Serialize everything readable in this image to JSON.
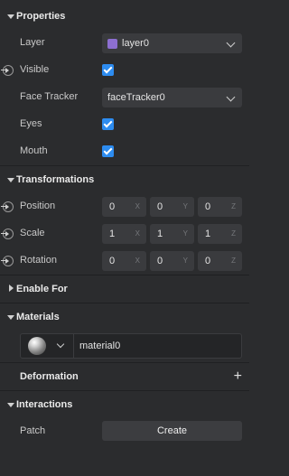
{
  "sections": {
    "properties": "Properties",
    "transformations": "Transformations",
    "enable_for": "Enable For",
    "materials": "Materials",
    "deformation": "Deformation",
    "interactions": "Interactions"
  },
  "properties": {
    "layer_label": "Layer",
    "layer_value": "layer0",
    "layer_color": "#8d6fd1",
    "visible_label": "Visible",
    "face_tracker_label": "Face Tracker",
    "face_tracker_value": "faceTracker0",
    "eyes_label": "Eyes",
    "mouth_label": "Mouth"
  },
  "transformations": {
    "position_label": "Position",
    "scale_label": "Scale",
    "rotation_label": "Rotation",
    "axes": [
      "X",
      "Y",
      "Z"
    ],
    "position": [
      "0",
      "0",
      "0"
    ],
    "scale": [
      "1",
      "1",
      "1"
    ],
    "rotation": [
      "0",
      "0",
      "0"
    ]
  },
  "materials": {
    "name": "material0"
  },
  "interactions": {
    "patch_label": "Patch",
    "create_label": "Create"
  },
  "colors": {
    "background": "#2b2c2e",
    "checkbox": "#2d8cf0",
    "field": "#3a3b3e"
  }
}
